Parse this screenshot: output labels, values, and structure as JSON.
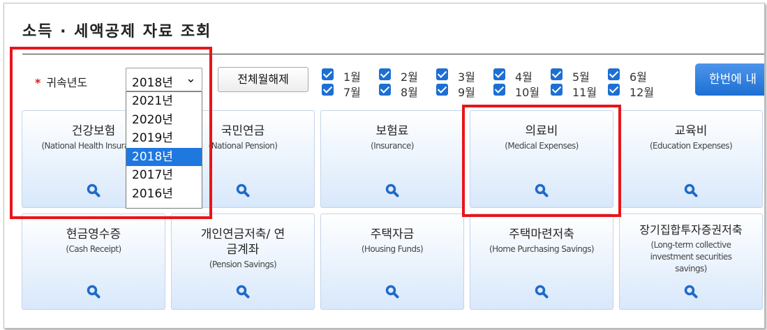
{
  "title": "소득 · 세액공제 자료 조회",
  "year_label": "귀속년도",
  "required_mark": "*",
  "year_select": {
    "value": "2018년",
    "options": [
      "2021년",
      "2020년",
      "2019년",
      "2018년",
      "2017년",
      "2016년"
    ],
    "selected_index": 3
  },
  "clear_all_label": "전체월해제",
  "months": [
    "1월",
    "2월",
    "3월",
    "4월",
    "5월",
    "6월",
    "7월",
    "8월",
    "9월",
    "10월",
    "11월",
    "12월"
  ],
  "lookup_all_label": "한번에 내",
  "colors": {
    "accent": "#1d6fd3",
    "highlight": "#e8151a"
  },
  "cards": [
    {
      "korean": "건강보험",
      "english": "(National Health Insurance)"
    },
    {
      "korean": "국민연금",
      "english": "(National Pension)"
    },
    {
      "korean": "보험료",
      "english": "(Insurance)"
    },
    {
      "korean": "의료비",
      "english": "(Medical Expenses)"
    },
    {
      "korean": "교육비",
      "english": "(Education Expenses)"
    },
    {
      "korean": "현금영수증",
      "english": "(Cash Receipt)"
    },
    {
      "korean": "개인연금저축/ 연금계좌",
      "english": "(Pension Savings)"
    },
    {
      "korean": "주택자금",
      "english": "(Housing Funds)"
    },
    {
      "korean": "주택마련저축",
      "english": "(Home Purchasing Savings)"
    },
    {
      "korean": "장기집합투자증권저축",
      "english": "(Long-term collective investment securities savings)"
    }
  ]
}
